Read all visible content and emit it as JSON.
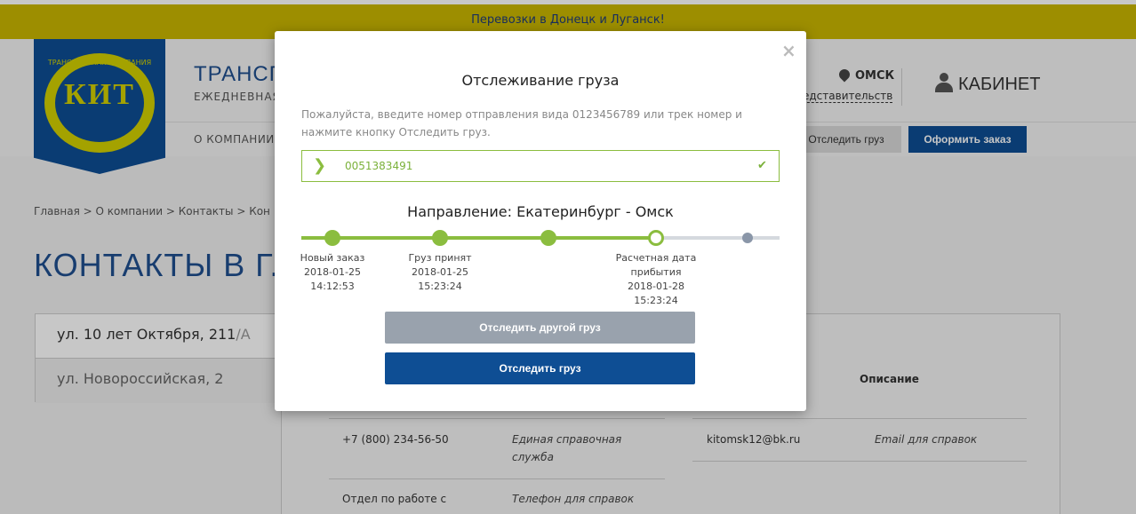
{
  "banner": {
    "text": "Перевозки в Донецк и Луганск!"
  },
  "header": {
    "logo_word": "КИТ",
    "logo_tag": "ТРАНСПОРТНАЯ КОМПАНИЯ",
    "brand_name": "ТРАНСПО",
    "brand_sub": "ЕЖЕДНЕВНАЯ",
    "nav_about": "О КОМПАНИИ",
    "city": "ОМСК",
    "city_link": "едставительств",
    "cabinet": "КАБИНЕТ",
    "track_button": "Отследить груз",
    "order_button": "Оформить заказ"
  },
  "breadcrumb": "Главная > О компании > Контакты > Кон",
  "page_title": "КОНТАКТЫ В Г. ОМ",
  "addresses": [
    {
      "main": "ул. 10 лет Октября, 211",
      "suffix": "/А"
    },
    {
      "main": "ул. Новороссийская, 2",
      "suffix": ""
    }
  ],
  "contacts": {
    "col_description": "Описание",
    "rows": [
      {
        "phone": "+7 (800) 234-56-50",
        "desc": "Единая справочная служба",
        "email": "kitomsk12@bk.ru",
        "email_desc": "Email для справок"
      },
      {
        "phone": "Отдел по работе с",
        "desc": "Телефон для справок"
      }
    ]
  },
  "modal": {
    "close": "×",
    "title": "Отслеживание груза",
    "hint": "Пожалуйста, введите номер отправления вида 0123456789 или трек номер и нажмите кнопку Отследить груз.",
    "input_value": "0051383491",
    "direction": "Направление: Екатеринбург - Омск",
    "progress_fraction": 0.74,
    "steps": [
      {
        "lines": [
          "Новый заказ",
          "2018-01-25",
          "14:12:53"
        ],
        "state": "done"
      },
      {
        "lines": [
          "Груз принят",
          "2018-01-25",
          "15:23:24"
        ],
        "state": "done"
      },
      {
        "lines": [],
        "state": "done"
      },
      {
        "lines": [
          "Расчетная дата",
          "прибытия",
          "2018-01-28",
          "15:23:24"
        ],
        "state": "current"
      },
      {
        "lines": [],
        "state": "pending"
      }
    ],
    "btn_other": "Отследить другой груз",
    "btn_track": "Отследить груз"
  },
  "colors": {
    "accent_green": "#8bbd3f",
    "brand_blue": "#0e4e94",
    "banner_yellow": "#c9b600"
  }
}
